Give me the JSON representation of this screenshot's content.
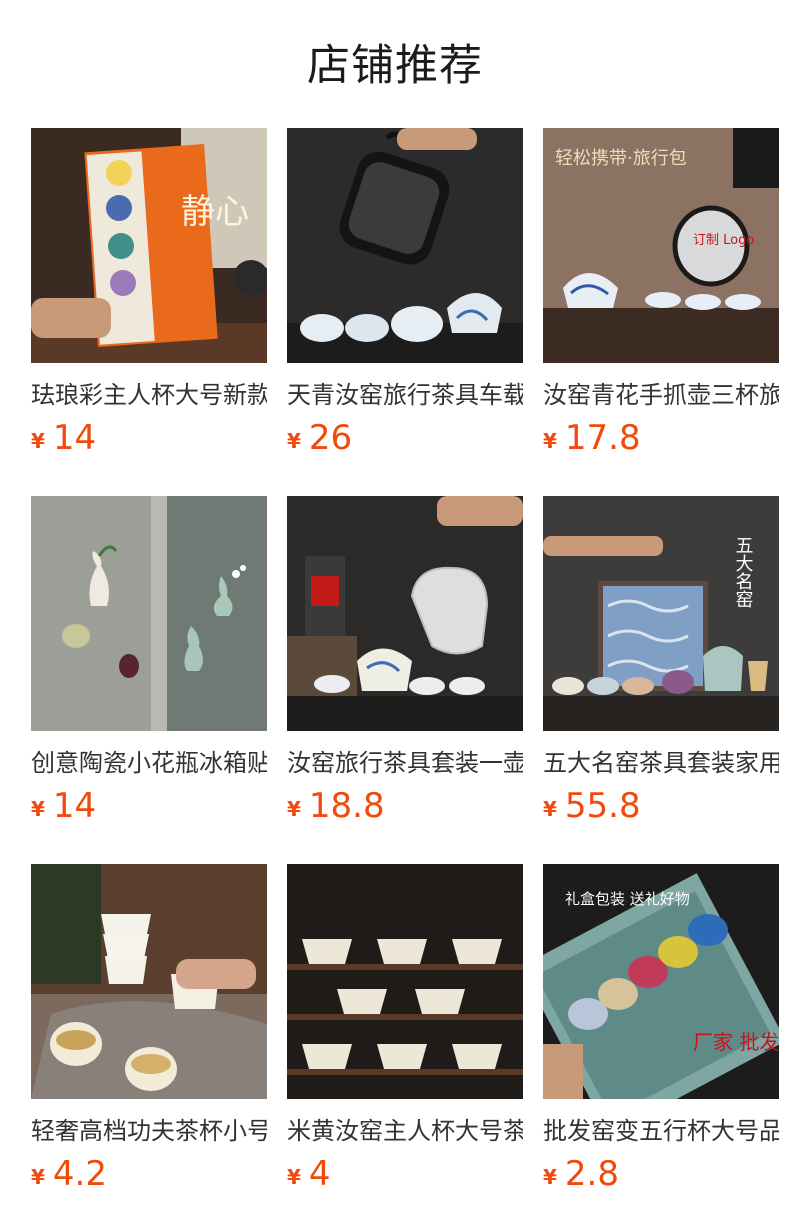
{
  "page": {
    "title": "店铺推荐"
  },
  "currency_symbol": "¥",
  "products": [
    {
      "title": "珐琅彩主人杯大号新款",
      "price": "14",
      "image_label": "enamel-cups-gift-box-image",
      "overlay_text": "静心"
    },
    {
      "title": "天青汝窑旅行茶具车载",
      "price": "26",
      "image_label": "travel-tea-set-case-image",
      "overlay_text": ""
    },
    {
      "title": "汝窑青花手抓壶三杯旅行",
      "price": "17.8",
      "image_label": "blue-white-teapot-travel-set-image",
      "overlay_text": "轻松携带·旅行包",
      "overlay_subtext": "订制 Logo"
    },
    {
      "title": "创意陶瓷小花瓶冰箱贴",
      "price": "14",
      "image_label": "ceramic-mini-vases-image",
      "overlay_text": ""
    },
    {
      "title": "汝窑旅行茶具套装一壶",
      "price": "18.8",
      "image_label": "ru-kiln-travel-tea-set-image",
      "overlay_text": ""
    },
    {
      "title": "五大名窑茶具套装家用",
      "price": "55.8",
      "image_label": "five-kilns-tea-set-image",
      "overlay_text": "五大名窑"
    },
    {
      "title": "轻奢高档功夫茶杯小号",
      "price": "4.2",
      "image_label": "white-porcelain-cups-image",
      "overlay_text": ""
    },
    {
      "title": "米黄汝窑主人杯大号茶",
      "price": "4",
      "image_label": "beige-ru-cups-image",
      "overlay_text": ""
    },
    {
      "title": "批发窑变五行杯大号品",
      "price": "2.8",
      "image_label": "kiln-change-five-cups-gift-box-image",
      "overlay_text": "礼盒包装 送礼好物",
      "overlay_subtext": "厂家 批发"
    }
  ],
  "colors": {
    "price": "#f04a0c",
    "title_text": "#333333",
    "header_text": "#1b1b1b"
  }
}
